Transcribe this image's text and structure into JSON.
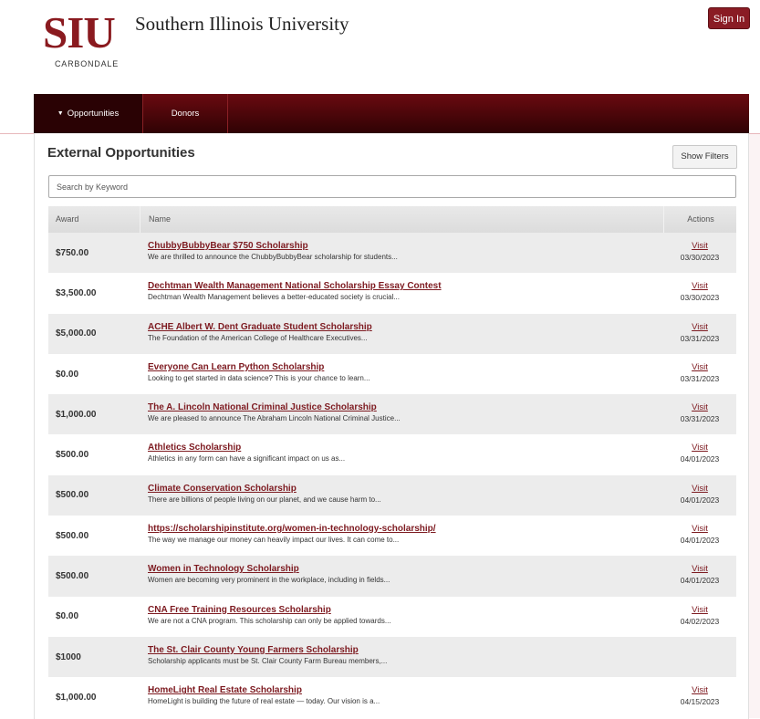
{
  "header": {
    "logo_mark": "SIU",
    "logo_name": "Southern Illinois University",
    "logo_sub": "CARBONDALE",
    "signin_label": "Sign In"
  },
  "nav": {
    "tabs": [
      {
        "label": "Opportunities",
        "active": true
      },
      {
        "label": "Donors",
        "active": false
      }
    ]
  },
  "main": {
    "title": "External Opportunities",
    "filters_label": "Show Filters",
    "search_placeholder": "Search by Keyword"
  },
  "table": {
    "columns": [
      "Award",
      "Name",
      "Actions"
    ],
    "rows": [
      {
        "award": "$750.00",
        "title": "ChubbyBubbyBear $750 Scholarship",
        "desc": "We are thrilled to announce the ChubbyBubbyBear scholarship for students...",
        "action": "Visit",
        "date": "03/30/2023"
      },
      {
        "award": "$3,500.00",
        "title": "Dechtman Wealth Management National Scholarship Essay Contest",
        "desc": "Dechtman Wealth Management believes a better-educated society is crucial...",
        "action": "Visit",
        "date": "03/30/2023"
      },
      {
        "award": "$5,000.00",
        "title": "ACHE Albert W. Dent Graduate Student Scholarship",
        "desc": "The Foundation of the American College of Healthcare Executives...",
        "action": "Visit",
        "date": "03/31/2023"
      },
      {
        "award": "$0.00",
        "title": "Everyone Can Learn Python Scholarship",
        "desc": "Looking to get started in data science? This is your chance to learn...",
        "action": "Visit",
        "date": "03/31/2023"
      },
      {
        "award": "$1,000.00",
        "title": "The A. Lincoln National Criminal Justice Scholarship",
        "desc": "We are pleased to announce The Abraham Lincoln National Criminal Justice...",
        "action": "Visit",
        "date": "03/31/2023"
      },
      {
        "award": "$500.00",
        "title": "Athletics Scholarship",
        "desc": "Athletics in any form can have a significant impact on us as...",
        "action": "Visit",
        "date": "04/01/2023"
      },
      {
        "award": "$500.00",
        "title": "Climate Conservation Scholarship",
        "desc": "There are billions of people living on our planet, and we cause harm to...",
        "action": "Visit",
        "date": "04/01/2023"
      },
      {
        "award": "$500.00",
        "title": "https://scholarshipinstitute.org/women-in-technology-scholarship/",
        "desc": "The way we manage our money can heavily impact our lives. It can come to...",
        "action": "Visit",
        "date": "04/01/2023"
      },
      {
        "award": "$500.00",
        "title": "Women in Technology Scholarship",
        "desc": "Women are becoming very prominent in the workplace, including in fields...",
        "action": "Visit",
        "date": "04/01/2023"
      },
      {
        "award": "$0.00",
        "title": "CNA Free Training Resources Scholarship",
        "desc": "We are not a CNA program. This scholarship can only be applied towards...",
        "action": "Visit",
        "date": "04/02/2023"
      },
      {
        "award": "$1000",
        "title": "The St. Clair County Young Farmers Scholarship",
        "desc": "Scholarship applicants must be St. Clair County Farm Bureau members,...",
        "action": "",
        "date": ""
      },
      {
        "award": "$1,000.00",
        "title": "HomeLight Real Estate Scholarship",
        "desc": "HomeLight is building the future of real estate — today. Our vision is a...",
        "action": "Visit",
        "date": "04/15/2023"
      }
    ]
  },
  "colors": {
    "brand": "#8a1a1f",
    "nav_dark": "#2f0204",
    "link": "#7d1a20",
    "row_alt": "#ececec"
  }
}
